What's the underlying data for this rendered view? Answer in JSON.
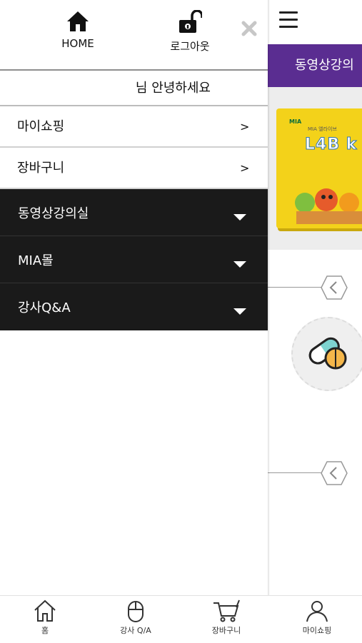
{
  "header": {
    "home_label": "HOME",
    "logout_label": "로그아웃"
  },
  "greeting": "님 안녕하세요",
  "menu": {
    "items": [
      {
        "label": "마이쇼핑",
        "arrow": ">"
      },
      {
        "label": "장바구니",
        "arrow": ">"
      }
    ],
    "categories": [
      {
        "label": "동영상강의실"
      },
      {
        "label": "MIA몰"
      },
      {
        "label": "강사Q&A"
      }
    ]
  },
  "background_page": {
    "banner_text": "동영상강의",
    "product": {
      "brand": "MIA",
      "caption": "MIA 엘라이브",
      "name": "L4B k"
    }
  },
  "tabbar": {
    "tabs": [
      {
        "label": "홈",
        "icon": "home-icon"
      },
      {
        "label": "강사 Q/A",
        "icon": "mouse-icon"
      },
      {
        "label": "장바구니",
        "icon": "cart-icon"
      },
      {
        "label": "마이쇼핑",
        "icon": "person-icon"
      }
    ]
  },
  "colors": {
    "drawer_dark": "#1a1a1a",
    "banner_purple": "#5a2d91",
    "product_yellow": "#f3d21a"
  }
}
